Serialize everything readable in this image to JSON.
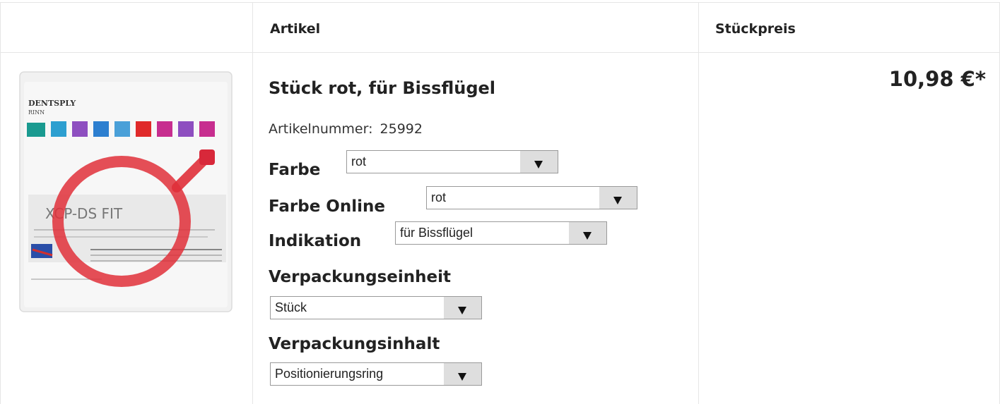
{
  "table": {
    "col_artikel": "Artikel",
    "col_stueckpreis": "Stückpreis"
  },
  "product": {
    "image_alt": "Dentsply Rinn XCP-DS FIT Positionierungsring rot",
    "image_label_brand": "DENTSPLY",
    "image_label_sub": "RINN",
    "image_label_product": "XCP-DS FIT",
    "title": "Stück rot, für Bissflügel",
    "artnr_label": "Artikelnummer:",
    "artnr_value": "25992",
    "price": "10,98 €*"
  },
  "options": {
    "farbe": {
      "label": "Farbe",
      "value": "rot"
    },
    "farbe_online": {
      "label": "Farbe Online",
      "value": "rot"
    },
    "indikation": {
      "label": "Indikation",
      "value": "für Bissflügel"
    },
    "verpackungseinheit": {
      "label": "Verpackungseinheit",
      "value": "Stück"
    },
    "verpackungsinhalt": {
      "label": "Verpackungsinhalt",
      "value": "Positionierungsring"
    }
  },
  "colors": {
    "ring": "#e0303a",
    "border": "#e6e6e6",
    "select_arrow_bg": "#dedede"
  }
}
